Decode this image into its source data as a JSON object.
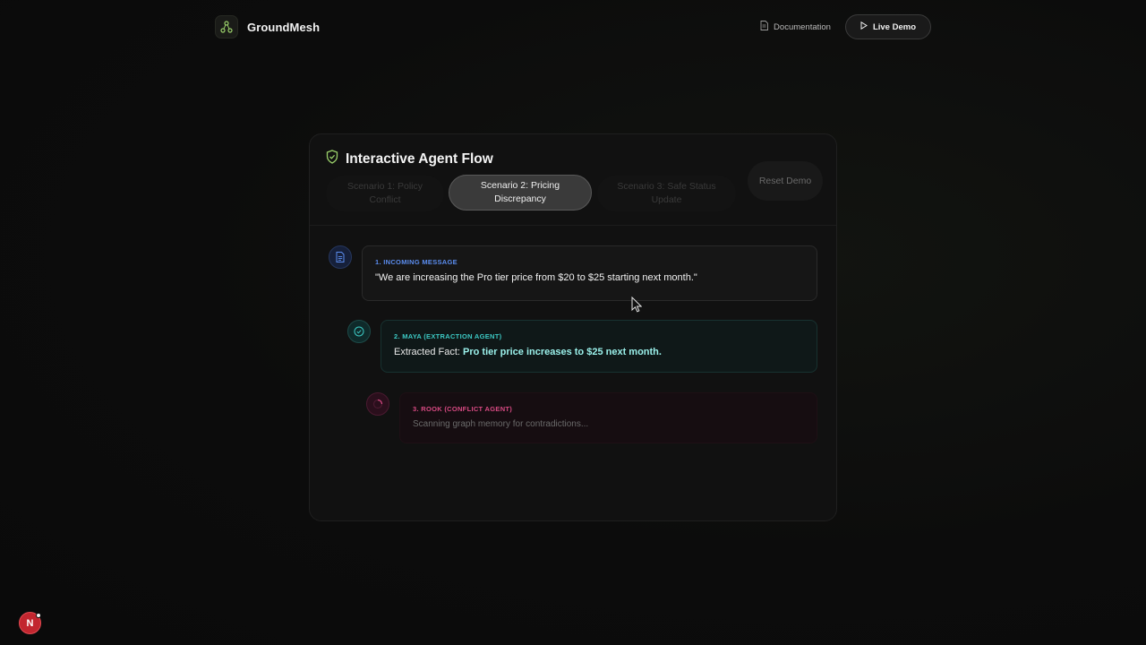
{
  "nav": {
    "brand_name": "GroundMesh",
    "brand_icon": "graph-nodes-icon",
    "doc_label": "Documentation",
    "live_demo_label": "Live Demo"
  },
  "card": {
    "title": "Interactive Agent Flow",
    "tabs": [
      {
        "label": "Scenario 1: Policy Conflict",
        "active": false
      },
      {
        "label": "Scenario 2: Pricing Discrepancy",
        "active": true
      },
      {
        "label": "Scenario 3: Safe Status Update",
        "active": false
      }
    ],
    "reset_label": "Reset Demo"
  },
  "steps": [
    {
      "label": "1. INCOMING MESSAGE",
      "text": "\"We are increasing the Pro tier price from $20 to $25 starting next month.\"",
      "icon": "document-icon"
    },
    {
      "label": "2. MAYA (EXTRACTION AGENT)",
      "prefix": "Extracted Fact: ",
      "fact": "Pro tier price increases to $25 next month.",
      "icon": "check-circle-icon"
    },
    {
      "label": "3. ROOK (CONFLICT AGENT)",
      "text": "Scanning graph memory for contradictions...",
      "icon": "spinner-icon"
    }
  ],
  "badge": {
    "letter": "N"
  },
  "colors": {
    "accent_green": "#9ad06a",
    "step1_blue": "#5b8def",
    "step2_teal": "#3cc9c4",
    "step3_pink": "#d84a83"
  }
}
